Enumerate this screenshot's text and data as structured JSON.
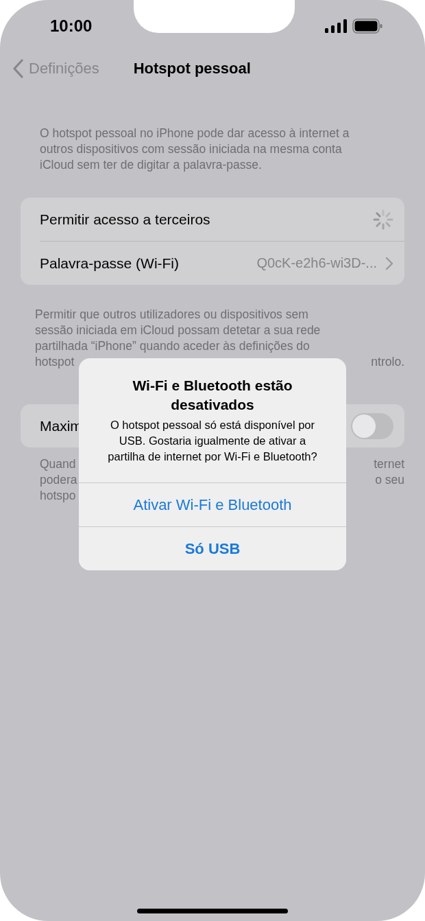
{
  "status_bar": {
    "time": "10:00"
  },
  "nav": {
    "back": "Definições",
    "title": "Hotspot pessoal"
  },
  "intro": "O hotspot pessoal no iPhone pode dar acesso à internet a outros dispositivos com sessão iniciada na mesma conta iCloud sem ter de digitar a palavra-passe.",
  "settings": [
    {
      "kind": "spinner",
      "label": "Permitir acesso a terceiros"
    },
    {
      "kind": "link",
      "label": "Palavra-passe (Wi-Fi)",
      "value": "Q0cK-e2h6-wi3D-..."
    }
  ],
  "access_footer": [
    {
      "left": "Permitir que outros utilizadores ou dispositivos sem"
    },
    {
      "left": "sessão iniciada em iCloud possam detetar a sua rede"
    },
    {
      "left": "partilhada “iPhone” quando aceder às definições do"
    },
    {
      "left": "hotspot",
      "right": "ntrolo."
    }
  ],
  "compat": {
    "label": "Maxim",
    "on": false
  },
  "compat_footer": [
    {
      "left": "Quand",
      "right": "ternet"
    },
    {
      "left": "podera",
      "right": "o seu"
    },
    {
      "left": "hotspo"
    }
  ],
  "alert": {
    "title": "Wi-Fi e Bluetooth estão desativados",
    "message": "O hotspot pessoal só está disponível por USB. Gostaria igualmente de ativar a partilha de internet por Wi-Fi e Bluetooth?",
    "buttons": [
      {
        "label": "Ativar Wi-Fi e Bluetooth",
        "bold": false
      },
      {
        "label": "Só USB",
        "bold": true
      }
    ]
  }
}
